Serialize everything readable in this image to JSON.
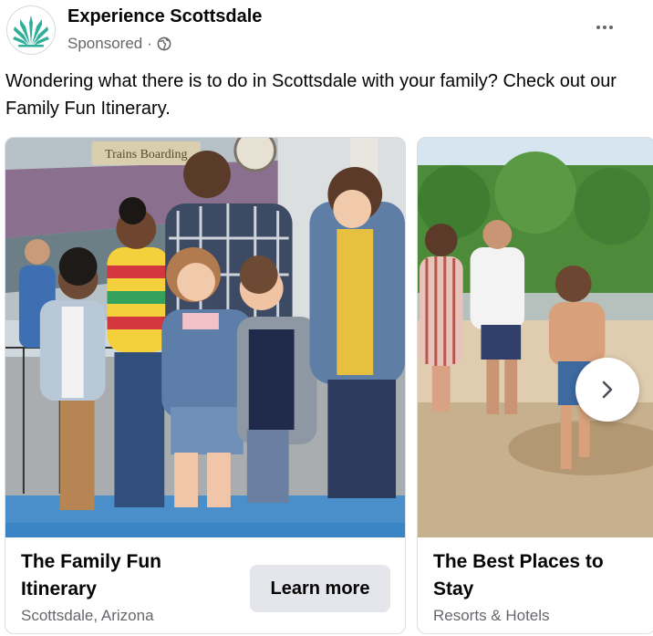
{
  "post": {
    "page_name": "Experience Scottsdale",
    "sponsored_label": "Sponsored",
    "separator": "·",
    "text": "Wondering what there is to do in Scottsdale with your family? Check out our Family Fun Itinerary."
  },
  "photo_text": {
    "sign": "Trains Boarding"
  },
  "cards": [
    {
      "title": "The Family Fun Itinerary",
      "subtitle": "Scottsdale, Arizona",
      "cta": "Learn more"
    },
    {
      "title": "The Best Places to Stay",
      "subtitle": "Resorts & Hotels"
    }
  ],
  "icons": {
    "avatar": "agave-logo-icon",
    "audience": "globe-icon",
    "menu": "more-horizontal-icon",
    "carousel_next": "chevron-right-icon"
  },
  "colors": {
    "brand_green": "#2fae98",
    "secondary_text": "#65676b",
    "button_bg": "#e4e6eb"
  }
}
